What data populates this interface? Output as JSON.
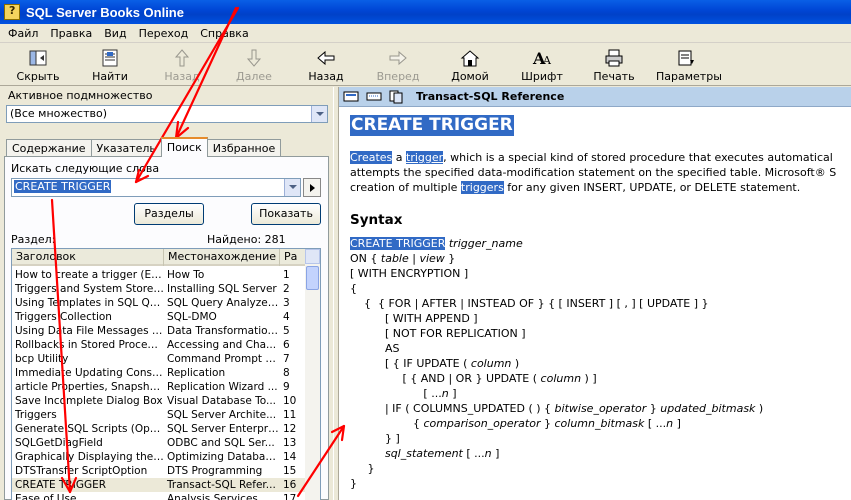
{
  "window": {
    "title": "SQL Server Books Online"
  },
  "menu": [
    "Файл",
    "Правка",
    "Вид",
    "Переход",
    "Справка"
  ],
  "toolbar": {
    "hide": "Скрыть",
    "find": "Найти",
    "back_disabled": "Назад",
    "forward_disabled": "Далее",
    "back": "Назад",
    "forward": "Вперед",
    "home": "Домой",
    "font": "Шрифт",
    "print": "Печать",
    "options": "Параметры"
  },
  "left": {
    "subset_label": "Активное подмножество",
    "subset_value": "(Все множество)",
    "tabs": [
      "Содержание",
      "Указатель",
      "Поиск",
      "Избранное"
    ],
    "search_label": "Искать следующие слова",
    "search_value": "CREATE TRIGGER",
    "sections_button": "Разделы",
    "show_button": "Показать",
    "section_label": "Раздел:",
    "found_label": "Найдено: 281",
    "columns": [
      "Заголовок",
      "Местонахождение",
      "Ра"
    ],
    "rows": [
      [
        "How to create a trigger (Ente...",
        "How To",
        "1"
      ],
      [
        "Triggers and System Stored ...",
        "Installing SQL Server",
        "2"
      ],
      [
        "Using Templates in SQL Que...",
        "SQL Query Analyzer...",
        "3"
      ],
      [
        "Triggers Collection",
        "SQL-DMO",
        "4"
      ],
      [
        "Using Data File Messages to ...",
        "Data Transformation...",
        "5"
      ],
      [
        "Rollbacks in Stored Procedur...",
        "Accessing and Cha...",
        "6"
      ],
      [
        "bcp Utility",
        "Command Prompt U...",
        "7"
      ],
      [
        "Immediate Updating Consider...",
        "Replication",
        "8"
      ],
      [
        "article Properties, Snapshot ...",
        "Replication Wizard ...",
        "9"
      ],
      [
        "Save Incomplete Dialog Box",
        "Visual Database To...",
        "10"
      ],
      [
        "Triggers",
        "SQL Server Archite...",
        "11"
      ],
      [
        "Generate SQL Scripts (Optio...",
        "SQL Server Enterpri...",
        "12"
      ],
      [
        "SQLGetDiagField",
        "ODBC and SQL Ser...",
        "13"
      ],
      [
        "Graphically Displaying the Ex...",
        "Optimizing Databas...",
        "14"
      ],
      [
        "DTSTransfer ScriptOption",
        "DTS Programming",
        "15"
      ],
      [
        "CREATE TRIGGER",
        "Transact-SQL Refer...",
        "16"
      ],
      [
        "Ease of Use",
        "Analysis Services",
        "17"
      ]
    ],
    "selected_index": 15
  },
  "right": {
    "header_title": "Transact-SQL Reference",
    "heading": "CREATE TRIGGER",
    "para": {
      "w1": "Creates",
      "t1": " a ",
      "w2": "trigger",
      "t2": ", which is a special kind of stored procedure that executes automatical",
      "line2": "attempts the specified data-modification statement on the specified table. Microsoft® S",
      "t3": "creation of multiple ",
      "w3": "triggers",
      "t4": " for any given INSERT, UPDATE, or DELETE statement."
    },
    "syntax_heading": "Syntax",
    "code": {
      "l1a": "CREATE TRIGGER",
      "l1b": " trigger",
      "l1c": "_name",
      "l2a": "ON { ",
      "l2b": "table",
      "l2c": " | ",
      "l2d": "view",
      "l2e": " }",
      "l3": "[ WITH ENCRYPTION ]",
      "l4": "{",
      "l5": "    {  { FOR | AFTER | INSTEAD OF } { [ INSERT ] [ , ] [ UPDATE ] }",
      "l6": "          [ WITH APPEND ]",
      "l7": "          [ NOT FOR REPLICATION ]",
      "l8": "          AS",
      "l9a": "          [ { IF UPDATE ( ",
      "l9b": "column",
      "l9c": " )",
      "l10a": "               [ { AND | OR } UPDATE ( ",
      "l10b": "column",
      "l10c": " ) ]",
      "l11a": "                     [ ...",
      "l11b": "n",
      "l11c": " ]",
      "l12a": "          | IF ( COLUMNS_UPDATED ( ) { ",
      "l12b": "bitwise_operator",
      "l12c": " } ",
      "l12d": "updated_bitmask",
      "l12e": " )",
      "l13a": "                  { ",
      "l13b": "comparison_operator",
      "l13c": " } ",
      "l13d": "column_bitmask",
      "l13e": " [ ...",
      "l13f": "n",
      "l13g": " ]",
      "l14": "          } ]",
      "l15a": "          ",
      "l15b": "sql_statement",
      "l15c": " [ ...",
      "l15d": "n",
      "l15e": " ]",
      "l16": "     }",
      "l17": "}"
    }
  },
  "colors": {
    "selection": "#316ac5",
    "title_bar": "#0047d6",
    "annotation": "#ff0000"
  }
}
